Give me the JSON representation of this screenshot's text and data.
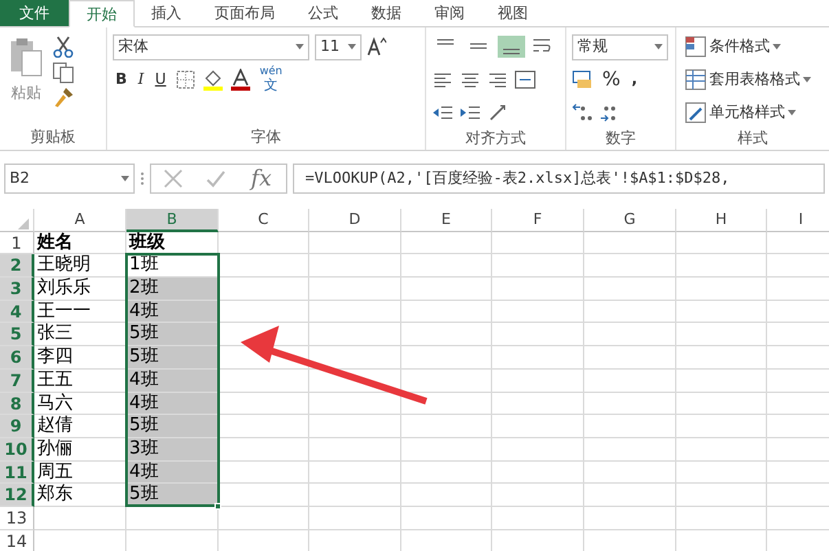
{
  "tabs": [
    {
      "label": "文件",
      "kind": "file",
      "selected": false
    },
    {
      "label": "开始",
      "kind": "tab",
      "selected": true
    },
    {
      "label": "插入",
      "kind": "tab",
      "selected": false
    },
    {
      "label": "页面布局",
      "kind": "tab",
      "selected": false
    },
    {
      "label": "公式",
      "kind": "tab",
      "selected": false
    },
    {
      "label": "数据",
      "kind": "tab",
      "selected": false
    },
    {
      "label": "审阅",
      "kind": "tab",
      "selected": false
    },
    {
      "label": "视图",
      "kind": "tab",
      "selected": false
    }
  ],
  "ribbon": {
    "clipboard": {
      "paste": "粘贴",
      "group": "剪贴板"
    },
    "font": {
      "name": "宋体",
      "size": "11",
      "bold": "B",
      "italic": "I",
      "underline": "U",
      "phonetic": [
        "wén",
        "文"
      ],
      "group": "字体"
    },
    "alignment": {
      "vertical": [
        {
          "selected": false
        },
        {
          "selected": false
        },
        {
          "selected": true
        }
      ],
      "group": "对齐方式"
    },
    "number": {
      "format": "常规",
      "percent": "%",
      "comma": ",",
      "group": "数字"
    },
    "styles": {
      "items": [
        "条件格式",
        "套用表格格式",
        "单元格样式"
      ],
      "group": "样式"
    }
  },
  "name_box": "B2",
  "function_label": "fx",
  "formula": "=VLOOKUP(A2,'[百度经验-表2.xlsx]总表'!$A$1:$D$28,",
  "columns": [
    {
      "label": "A",
      "selected": false
    },
    {
      "label": "B",
      "selected": true
    },
    {
      "label": "C",
      "selected": false
    },
    {
      "label": "D",
      "selected": false
    },
    {
      "label": "E",
      "selected": false
    },
    {
      "label": "F",
      "selected": false
    },
    {
      "label": "G",
      "selected": false
    },
    {
      "label": "H",
      "selected": false
    },
    {
      "label": "I",
      "selected": false
    }
  ],
  "rows": [
    {
      "number": "1",
      "kind": "header",
      "selected": false,
      "cells": [
        "姓名",
        "班级"
      ]
    },
    {
      "number": "2",
      "kind": "data",
      "selected": true,
      "cells": [
        "王晓明",
        "1班"
      ]
    },
    {
      "number": "3",
      "kind": "data",
      "selected": true,
      "cells": [
        "刘乐乐",
        "2班"
      ]
    },
    {
      "number": "4",
      "kind": "data",
      "selected": true,
      "cells": [
        "王一一",
        "4班"
      ]
    },
    {
      "number": "5",
      "kind": "data",
      "selected": true,
      "cells": [
        "张三",
        "5班"
      ]
    },
    {
      "number": "6",
      "kind": "data",
      "selected": true,
      "cells": [
        "李四",
        "5班"
      ]
    },
    {
      "number": "7",
      "kind": "data",
      "selected": true,
      "cells": [
        "王五",
        "4班"
      ]
    },
    {
      "number": "8",
      "kind": "data",
      "selected": true,
      "cells": [
        "马六",
        "4班"
      ]
    },
    {
      "number": "9",
      "kind": "data",
      "selected": true,
      "cells": [
        "赵倩",
        "5班"
      ]
    },
    {
      "number": "10",
      "kind": "data",
      "selected": true,
      "cells": [
        "孙俪",
        "3班"
      ]
    },
    {
      "number": "11",
      "kind": "data",
      "selected": true,
      "cells": [
        "周五",
        "4班"
      ]
    },
    {
      "number": "12",
      "kind": "data",
      "selected": true,
      "cells": [
        "郑东",
        "5班"
      ]
    },
    {
      "number": "13",
      "kind": "data",
      "selected": false,
      "cells": []
    },
    {
      "number": "14",
      "kind": "data",
      "selected": false,
      "cells": []
    }
  ]
}
